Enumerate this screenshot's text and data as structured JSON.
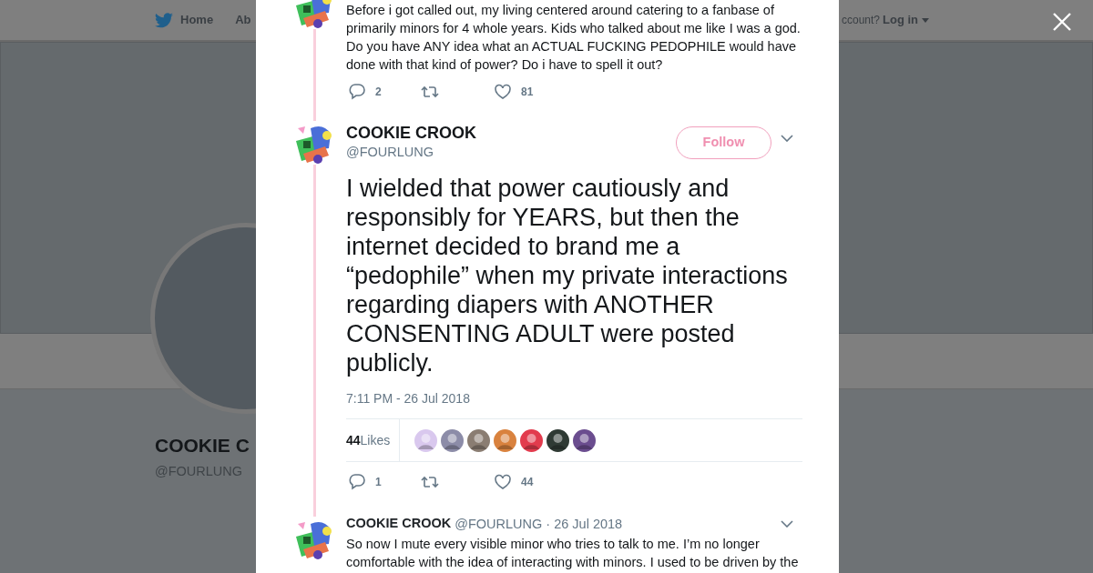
{
  "background": {
    "nav": {
      "home": "Home",
      "about": "Ab",
      "account_prompt": "ccount?",
      "login": "Log in"
    },
    "profile": {
      "name": "COOKIE C",
      "handle": "@FOURLUNG"
    }
  },
  "tweets": [
    {
      "kind": "thread",
      "text": "Before i got called out, my living centered around catering to a fanbase of primarily minors for 4 whole years. Kids who talked about me like I was a god. Do you have ANY idea what an ACTUAL FUCKING PEDOPHILE would have done with that kind of power? Do i have to spell it out?",
      "replies": "2",
      "likes": "81"
    },
    {
      "kind": "focused",
      "name": "COOKIE CROOK",
      "handle": "@FOURLUNG",
      "follow": "Follow",
      "text": "I wielded that power cautiously and responsibly for YEARS, but then the internet decided to brand me a “pedophile” when my private interactions regarding diapers with ANOTHER CONSENTING ADULT were posted publicly.",
      "time": "7:11 PM - 26 Jul 2018",
      "like_count": "44",
      "likes_label": "Likes",
      "likers": [
        {
          "color": "#d9c8ee"
        },
        {
          "color": "#8c8ca8"
        },
        {
          "color": "#8a7d72"
        },
        {
          "color": "#d9823e"
        },
        {
          "color": "#e23b4d"
        },
        {
          "color": "#2f3a34"
        },
        {
          "color": "#6b4d8f"
        }
      ],
      "replies": "1",
      "likes": "44"
    },
    {
      "kind": "reply",
      "name": "COOKIE CROOK",
      "handle": "@FOURLUNG",
      "date": "· 26 Jul 2018",
      "text": "So now I mute every visible minor who tries to talk to me. I’m no longer comfortable with the idea of interacting with minors. I used to be driven by the"
    }
  ]
}
